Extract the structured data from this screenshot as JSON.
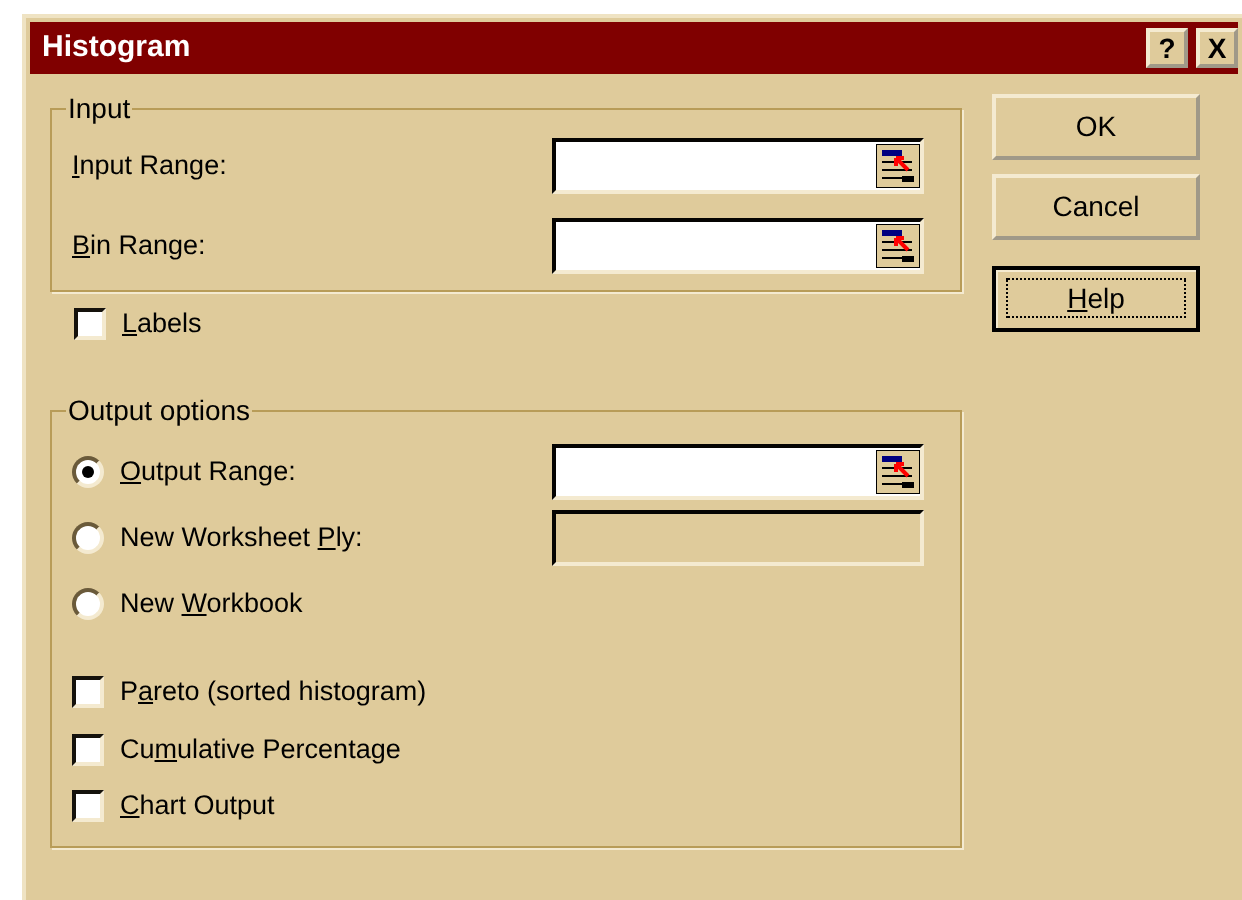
{
  "window": {
    "title": "Histogram",
    "title_buttons": [
      "?",
      "X"
    ]
  },
  "input_group": {
    "title": "Input",
    "fields": [
      {
        "label": {
          "key": "I",
          "after": "nput Range:"
        },
        "disabled": false
      },
      {
        "label": {
          "key": "B",
          "after": "in Range:"
        },
        "disabled": false
      }
    ]
  },
  "labels_checkbox": {
    "label": {
      "key": "L",
      "after": "abels"
    },
    "checked": false
  },
  "output_group": {
    "title": "Output options",
    "options": [
      {
        "label": {
          "key": "O",
          "after": "utput Range:"
        },
        "selected": true,
        "field": {
          "disabled": false
        }
      },
      {
        "label": {
          "before": "New Worksheet ",
          "key": "P",
          "after": "ly:"
        },
        "selected": false,
        "field": {
          "disabled": true
        }
      },
      {
        "label": {
          "before": "New ",
          "key": "W",
          "after": "orkbook"
        },
        "selected": false
      }
    ],
    "checkboxes": [
      {
        "label": {
          "before": "P",
          "key": "a",
          "after": "reto (sorted histogram)"
        },
        "checked": false
      },
      {
        "label": {
          "before": "Cu",
          "key": "m",
          "after": "ulative Percentage"
        },
        "checked": false
      },
      {
        "label": {
          "key": "C",
          "after": "hart Output"
        },
        "checked": false
      }
    ]
  },
  "buttons": [
    {
      "label": {
        "after": "OK"
      },
      "focused": false
    },
    {
      "label": {
        "after": "Cancel"
      },
      "focused": false
    },
    {
      "label": {
        "key": "H",
        "after": "elp"
      },
      "focused": true
    }
  ]
}
